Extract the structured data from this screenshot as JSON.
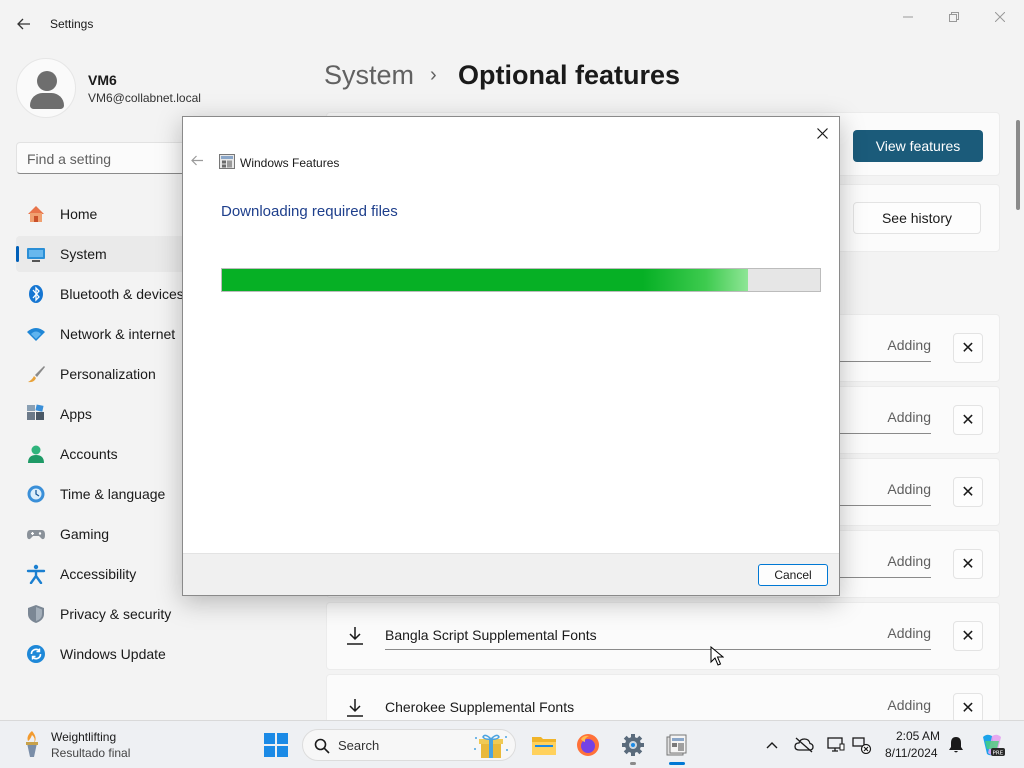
{
  "window": {
    "title": "Settings",
    "minimize_icon": "minimize-icon",
    "maximize_icon": "restore-icon",
    "close_icon": "close-icon"
  },
  "user": {
    "name": "VM6",
    "email": "VM6@collabnet.local"
  },
  "search": {
    "placeholder": "Find a setting"
  },
  "sidebar": {
    "items": [
      {
        "label": "Home",
        "icon": "home-icon"
      },
      {
        "label": "System",
        "icon": "system-icon",
        "active": true
      },
      {
        "label": "Bluetooth & devices",
        "icon": "bluetooth-icon"
      },
      {
        "label": "Network & internet",
        "icon": "wifi-icon"
      },
      {
        "label": "Personalization",
        "icon": "brush-icon"
      },
      {
        "label": "Apps",
        "icon": "apps-icon"
      },
      {
        "label": "Accounts",
        "icon": "accounts-icon"
      },
      {
        "label": "Time & language",
        "icon": "clock-globe-icon"
      },
      {
        "label": "Gaming",
        "icon": "gamepad-icon"
      },
      {
        "label": "Accessibility",
        "icon": "accessibility-icon"
      },
      {
        "label": "Privacy & security",
        "icon": "shield-icon"
      },
      {
        "label": "Windows Update",
        "icon": "update-icon"
      }
    ]
  },
  "main": {
    "breadcrumb_parent": "System",
    "breadcrumb_chevron": "›",
    "page_title": "Optional features",
    "view_features_label": "View features",
    "see_history_label": "See history",
    "features": [
      {
        "name": "",
        "status": "Adding"
      },
      {
        "name": "",
        "status": "Adding"
      },
      {
        "name": "",
        "status": "Adding"
      },
      {
        "name": "",
        "status": "Adding"
      },
      {
        "name": "Bangla Script Supplemental Fonts",
        "status": "Adding"
      },
      {
        "name": "Cherokee Supplemental Fonts",
        "status": "Adding"
      }
    ]
  },
  "dialog": {
    "title": "Windows Features",
    "heading": "Downloading required files",
    "progress": 0.88,
    "cancel_label": "Cancel"
  },
  "taskbar": {
    "weather_title": "Weightlifting",
    "weather_subtitle": "Resultado final",
    "search_label": "Search",
    "time": "2:05 AM",
    "date": "8/11/2024"
  },
  "colors": {
    "accent": "#005fb8",
    "primary_button": "#1b5b7a",
    "progress_green": "#06b025",
    "dialog_heading": "#1e3f8c"
  }
}
